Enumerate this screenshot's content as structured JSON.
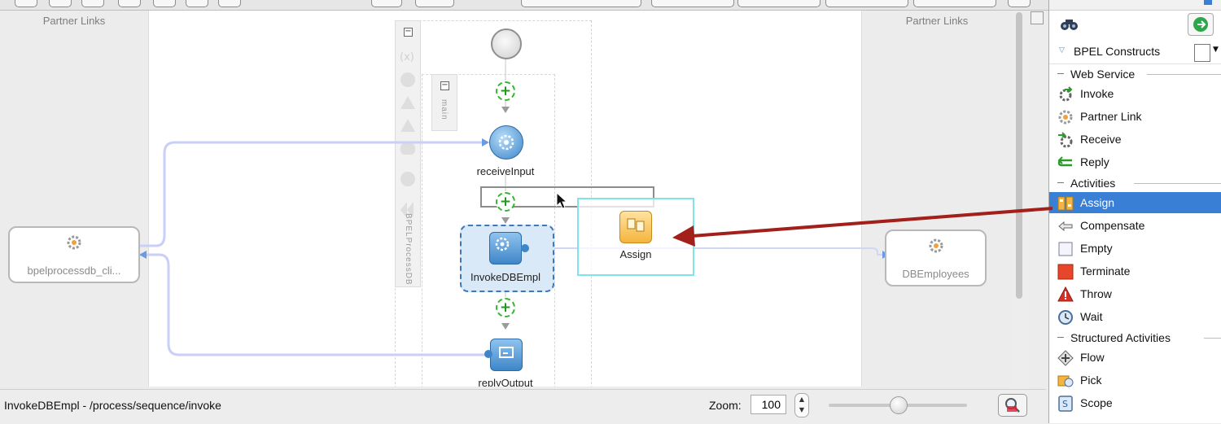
{
  "canvas": {
    "partner_links_left_title": "Partner Links",
    "partner_links_right_title": "Partner Links",
    "left_partner": "bpelprocessdb_cli...",
    "right_partner": "DBEmployees",
    "process_label": "BPELProcessDB",
    "sequence_label": "main",
    "activities": {
      "receive": "receiveInput",
      "invoke": "InvokeDBEmpl",
      "reply": "replyOutput",
      "assign_drop": "Assign"
    }
  },
  "status": {
    "path": "InvokeDBEmpl - /process/sequence/invoke",
    "zoom_label": "Zoom:",
    "zoom_value": "100",
    "zoom_slider_fraction": 0.5
  },
  "palette": {
    "header": "BPEL Constructs",
    "sections": {
      "web_service": "Web Service",
      "activities": "Activities",
      "structured": "Structured Activities"
    },
    "web_service_items": [
      "Invoke",
      "Partner Link",
      "Receive",
      "Reply"
    ],
    "activity_items": [
      "Assign",
      "Compensate",
      "Empty",
      "Terminate",
      "Throw",
      "Wait"
    ],
    "structured_items": [
      "Flow",
      "Pick",
      "Scope"
    ],
    "selected": "Assign"
  },
  "colors": {
    "selection": "#3a7fd6",
    "drag_arrow": "#a3201a",
    "connector": "#c9cff7",
    "add_icon": "#35b535"
  }
}
